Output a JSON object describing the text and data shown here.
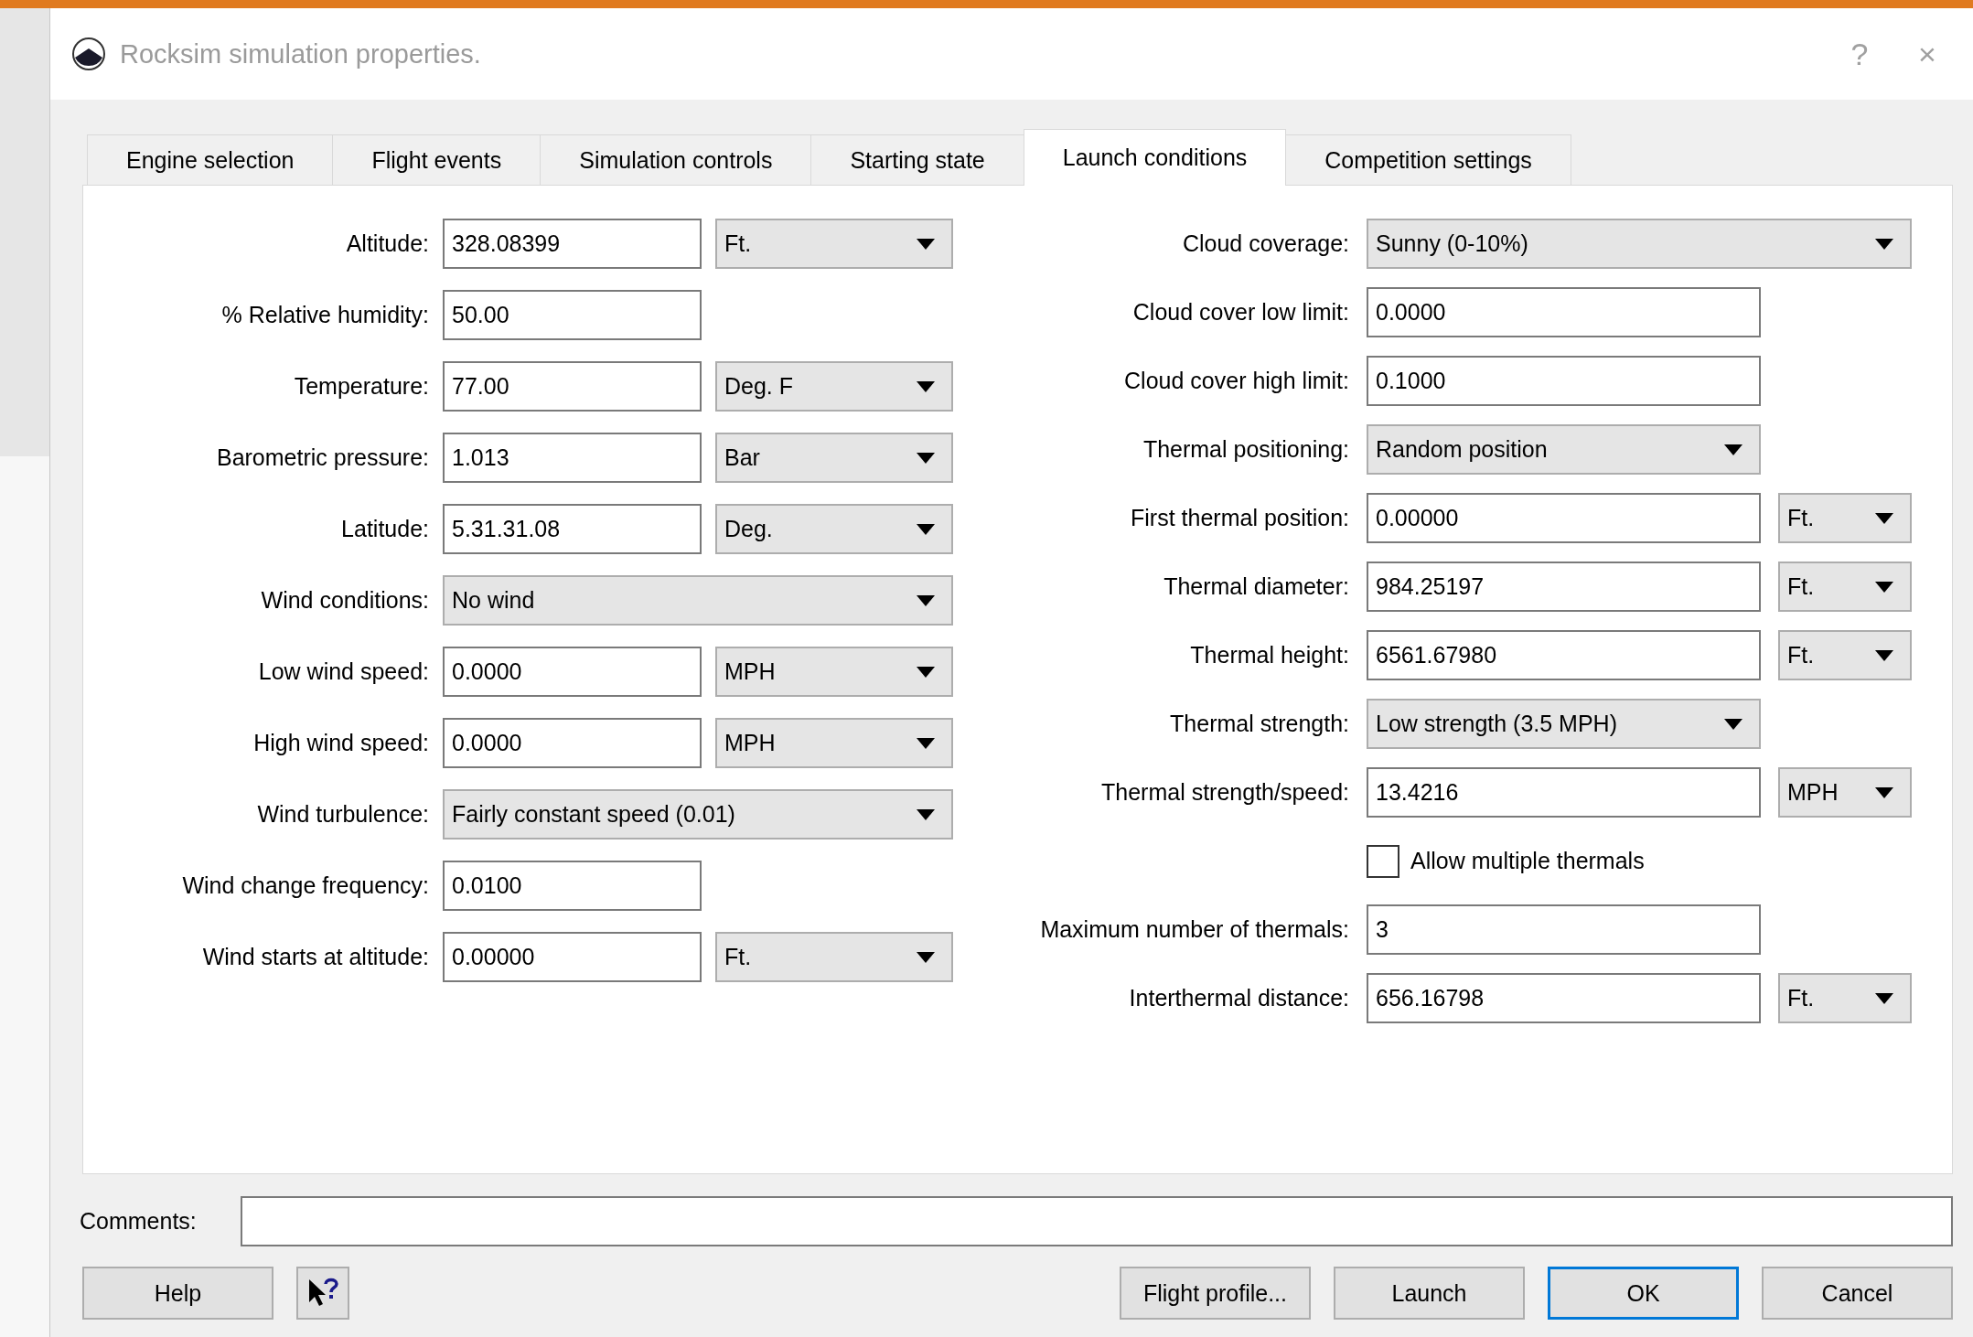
{
  "window": {
    "title": "Rocksim simulation properties.",
    "help_glyph": "?",
    "close_glyph": "×"
  },
  "tabs": [
    {
      "label": "Engine selection",
      "selected": false
    },
    {
      "label": "Flight events",
      "selected": false
    },
    {
      "label": "Simulation controls",
      "selected": false
    },
    {
      "label": "Starting state",
      "selected": false
    },
    {
      "label": "Launch conditions",
      "selected": true
    },
    {
      "label": "Competition settings",
      "selected": false
    }
  ],
  "left_fields": [
    {
      "kind": "field_unit",
      "label": "Altitude:",
      "value": "328.08399",
      "unit": "Ft."
    },
    {
      "kind": "field",
      "label": "% Relative humidity:",
      "value": "50.00"
    },
    {
      "kind": "field_unit",
      "label": "Temperature:",
      "value": "77.00",
      "unit": "Deg. F"
    },
    {
      "kind": "field_unit",
      "label": "Barometric pressure:",
      "value": "1.013",
      "unit": "Bar"
    },
    {
      "kind": "field_unit",
      "label": "Latitude:",
      "value": "5.31.31.08",
      "unit": "Deg."
    },
    {
      "kind": "dropdown_wide",
      "label": "Wind conditions:",
      "value": "No wind"
    },
    {
      "kind": "field_unit",
      "label": "Low wind speed:",
      "value": "0.0000",
      "unit": "MPH"
    },
    {
      "kind": "field_unit",
      "label": "High wind speed:",
      "value": "0.0000",
      "unit": "MPH"
    },
    {
      "kind": "dropdown_wide",
      "label": "Wind turbulence:",
      "value": "Fairly constant speed (0.01)"
    },
    {
      "kind": "field",
      "label": "Wind change frequency:",
      "value": "0.0100"
    },
    {
      "kind": "field_unit",
      "label": "Wind starts at altitude:",
      "value": "0.00000",
      "unit": "Ft."
    }
  ],
  "right_fields": [
    {
      "kind": "dropdown_wide",
      "label": "Cloud coverage:",
      "value": "Sunny (0-10%)"
    },
    {
      "kind": "field",
      "label": "Cloud cover low limit:",
      "value": "0.0000"
    },
    {
      "kind": "field",
      "label": "Cloud cover high limit:",
      "value": "0.1000"
    },
    {
      "kind": "dropdown",
      "label": "Thermal positioning:",
      "value": "Random position"
    },
    {
      "kind": "field_unit",
      "label": "First thermal position:",
      "value": "0.00000",
      "unit": "Ft."
    },
    {
      "kind": "field_unit",
      "label": "Thermal diameter:",
      "value": "984.25197",
      "unit": "Ft."
    },
    {
      "kind": "field_unit",
      "label": "Thermal height:",
      "value": "6561.67980",
      "unit": "Ft."
    },
    {
      "kind": "dropdown",
      "label": "Thermal strength:",
      "value": "Low strength (3.5 MPH)"
    },
    {
      "kind": "field_unit",
      "label": "Thermal strength/speed:",
      "value": "13.4216",
      "unit": "MPH"
    },
    {
      "kind": "checkbox",
      "label": "Allow multiple thermals",
      "checked": false
    },
    {
      "kind": "field",
      "label": "Maximum number of thermals:",
      "value": "3"
    },
    {
      "kind": "field_unit",
      "label": "Interthermal distance:",
      "value": "656.16798",
      "unit": "Ft."
    }
  ],
  "comments": {
    "label": "Comments:"
  },
  "buttons": [
    {
      "kind": "text",
      "label": "Help",
      "default": false
    },
    {
      "kind": "help_pointer"
    },
    {
      "kind": "spacer"
    },
    {
      "kind": "text",
      "label": "Flight profile...",
      "default": false
    },
    {
      "kind": "text",
      "label": "Launch",
      "default": false
    },
    {
      "kind": "text",
      "label": "OK",
      "default": true
    },
    {
      "kind": "text",
      "label": "Cancel",
      "default": false
    }
  ]
}
